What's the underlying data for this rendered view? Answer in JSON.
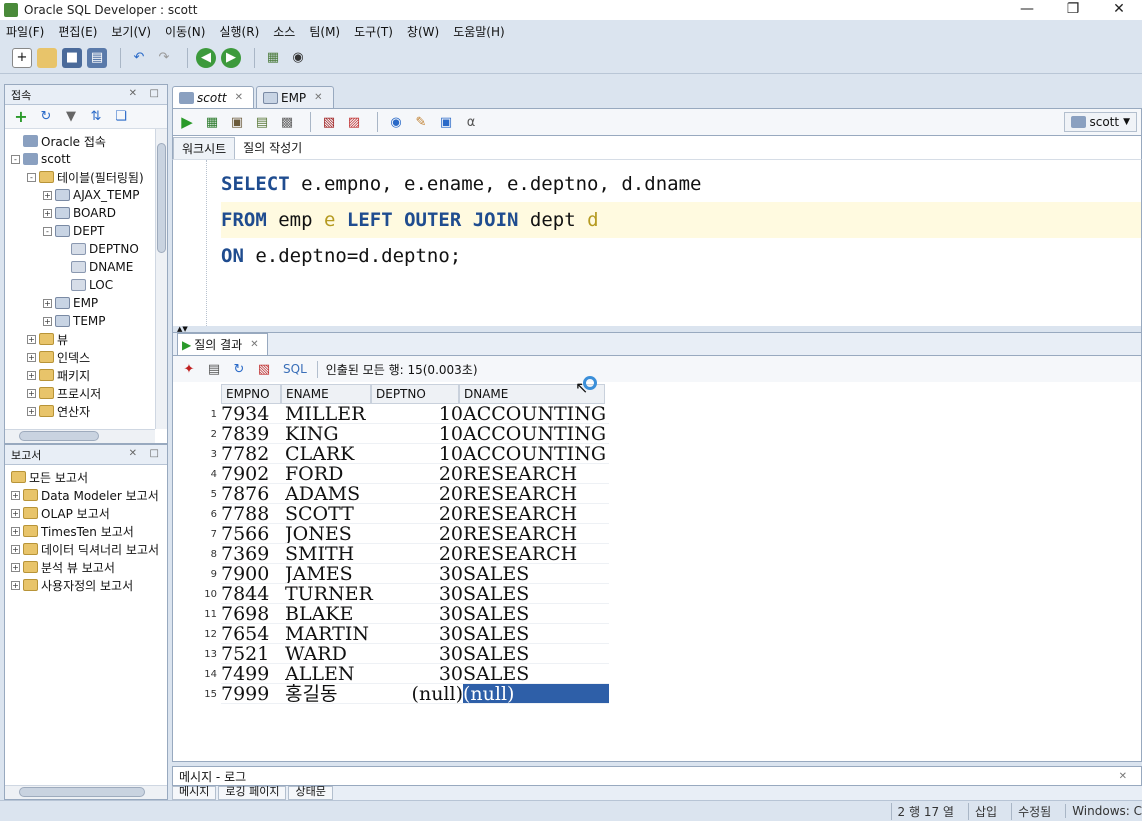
{
  "window": {
    "title": "Oracle SQL Developer : scott"
  },
  "menu": [
    "파일(F)",
    "편집(E)",
    "보기(V)",
    "이동(N)",
    "실행(R)",
    "소스",
    "팀(M)",
    "도구(T)",
    "창(W)",
    "도움말(H)"
  ],
  "connections_panel": {
    "title": "접속",
    "tree": [
      {
        "label": "Oracle 접속",
        "icon": "database-icon",
        "level": 0,
        "pm": ""
      },
      {
        "label": "scott",
        "icon": "database-icon",
        "level": 0,
        "pm": "-"
      },
      {
        "label": "테이블(필터링됨)",
        "icon": "folder-icon",
        "level": 1,
        "pm": "-"
      },
      {
        "label": "AJAX_TEMP",
        "icon": "table-icon",
        "level": 2,
        "pm": "+"
      },
      {
        "label": "BOARD",
        "icon": "table-icon",
        "level": 2,
        "pm": "+"
      },
      {
        "label": "DEPT",
        "icon": "table-icon",
        "level": 2,
        "pm": "-"
      },
      {
        "label": "DEPTNO",
        "icon": "column-icon",
        "level": 3,
        "pm": ""
      },
      {
        "label": "DNAME",
        "icon": "column-icon",
        "level": 3,
        "pm": ""
      },
      {
        "label": "LOC",
        "icon": "column-icon",
        "level": 3,
        "pm": ""
      },
      {
        "label": "EMP",
        "icon": "table-icon",
        "level": 2,
        "pm": "+"
      },
      {
        "label": "TEMP",
        "icon": "table-icon",
        "level": 2,
        "pm": "+"
      },
      {
        "label": "뷰",
        "icon": "folder-icon",
        "level": 1,
        "pm": "+"
      },
      {
        "label": "인덱스",
        "icon": "folder-icon",
        "level": 1,
        "pm": "+"
      },
      {
        "label": "패키지",
        "icon": "folder-icon",
        "level": 1,
        "pm": "+"
      },
      {
        "label": "프로시저",
        "icon": "folder-icon",
        "level": 1,
        "pm": "+"
      },
      {
        "label": "연산자",
        "icon": "folder-icon",
        "level": 1,
        "pm": "+"
      }
    ]
  },
  "reports_panel": {
    "title": "보고서",
    "tree": [
      {
        "label": "모든 보고서",
        "icon": "report-icon",
        "pm": ""
      },
      {
        "label": "Data Modeler 보고서",
        "icon": "folder-icon",
        "pm": "+"
      },
      {
        "label": "OLAP 보고서",
        "icon": "folder-icon",
        "pm": "+"
      },
      {
        "label": "TimesTen 보고서",
        "icon": "folder-icon",
        "pm": "+"
      },
      {
        "label": "데이터 딕셔너리 보고서",
        "icon": "folder-icon",
        "pm": "+"
      },
      {
        "label": "분석 뷰 보고서",
        "icon": "folder-icon",
        "pm": "+"
      },
      {
        "label": "사용자정의 보고서",
        "icon": "folder-icon",
        "pm": "+"
      }
    ]
  },
  "editor": {
    "tabs": [
      {
        "label": "scott"
      },
      {
        "label": "EMP"
      }
    ],
    "connection": "scott",
    "subtabs": [
      "워크시트",
      "질의 작성기"
    ],
    "lines": [
      [
        {
          "t": "SELECT",
          "k": "kw"
        },
        {
          "t": " e.empno, e.ename, e.deptno, d.dname",
          "k": ""
        }
      ],
      [
        {
          "t": "FROM",
          "k": "kw"
        },
        {
          "t": " emp ",
          "k": ""
        },
        {
          "t": "e",
          "k": "alias"
        },
        {
          "t": " ",
          "k": ""
        },
        {
          "t": "LEFT OUTER JOIN",
          "k": "kw"
        },
        {
          "t": " dept ",
          "k": ""
        },
        {
          "t": "d",
          "k": "alias"
        }
      ],
      [
        {
          "t": "ON",
          "k": "kw"
        },
        {
          "t": " e.deptno=d.deptno;",
          "k": ""
        }
      ]
    ]
  },
  "results": {
    "tab": "질의 결과",
    "sql_label": "SQL",
    "row_count_text": "인출된 모든 행: 15(0.003초)",
    "columns": [
      "EMPNO",
      "ENAME",
      "DEPTNO",
      "DNAME"
    ],
    "rows": [
      [
        "1",
        "7934",
        "MILLER",
        "10",
        "ACCOUNTING"
      ],
      [
        "2",
        "7839",
        "KING",
        "10",
        "ACCOUNTING"
      ],
      [
        "3",
        "7782",
        "CLARK",
        "10",
        "ACCOUNTING"
      ],
      [
        "4",
        "7902",
        "FORD",
        "20",
        "RESEARCH"
      ],
      [
        "5",
        "7876",
        "ADAMS",
        "20",
        "RESEARCH"
      ],
      [
        "6",
        "7788",
        "SCOTT",
        "20",
        "RESEARCH"
      ],
      [
        "7",
        "7566",
        "JONES",
        "20",
        "RESEARCH"
      ],
      [
        "8",
        "7369",
        "SMITH",
        "20",
        "RESEARCH"
      ],
      [
        "9",
        "7900",
        "JAMES",
        "30",
        "SALES"
      ],
      [
        "10",
        "7844",
        "TURNER",
        "30",
        "SALES"
      ],
      [
        "11",
        "7698",
        "BLAKE",
        "30",
        "SALES"
      ],
      [
        "12",
        "7654",
        "MARTIN",
        "30",
        "SALES"
      ],
      [
        "13",
        "7521",
        "WARD",
        "30",
        "SALES"
      ],
      [
        "14",
        "7499",
        "ALLEN",
        "30",
        "SALES"
      ],
      [
        "15",
        "7999",
        "홍길동",
        "(null)",
        "(null)"
      ]
    ]
  },
  "messages": {
    "title": "메시지 - 로그",
    "tabs": [
      "메시지",
      "로깅 페이지",
      "상태문"
    ]
  },
  "status": {
    "position": "2 행 17 열",
    "mode": "삽입",
    "modified": "수정됨",
    "os": "Windows: C"
  }
}
